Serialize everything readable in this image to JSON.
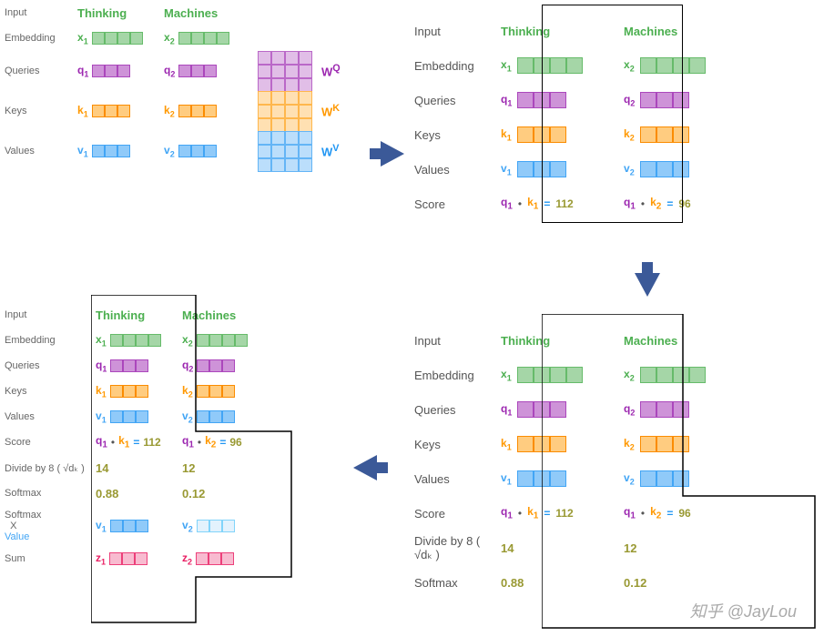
{
  "words": {
    "w1": "Thinking",
    "w2": "Machines"
  },
  "labels": {
    "input": "Input",
    "embedding": "Embedding",
    "queries": "Queries",
    "keys": "Keys",
    "values": "Values",
    "score": "Score",
    "divide": "Divide by 8 ( √dₖ  )",
    "softmax": "Softmax",
    "softmaxxvalue": "Softmax\n  X\nValue",
    "sum": "Sum"
  },
  "vecs": {
    "x1": "x",
    "x2": "x",
    "q1": "q",
    "q2": "q",
    "k1": "k",
    "k2": "k",
    "v1": "v",
    "v2": "v",
    "z1": "z",
    "z2": "z"
  },
  "weights": {
    "wq": "W",
    "wk": "W",
    "wv": "W"
  },
  "scores": {
    "dot1": {
      "q": "q₁",
      "dot": " • ",
      "k": "k₁",
      "eq": " = ",
      "val": "112"
    },
    "dot2": {
      "q": "q₁",
      "dot": " • ",
      "k": "k₂",
      "eq": " = ",
      "val": "96"
    },
    "div1": "14",
    "div2": "12",
    "sm1": "0.88",
    "sm2": "0.12"
  },
  "watermark": "知乎 @JayLou"
}
